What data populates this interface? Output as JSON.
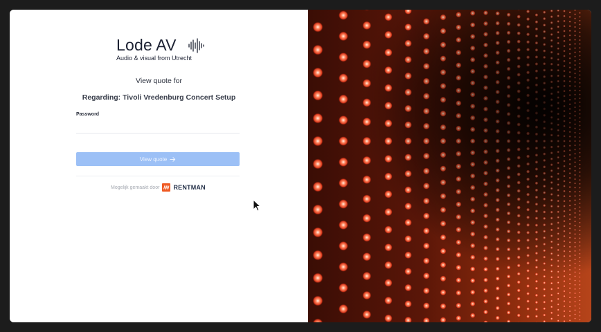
{
  "logo": {
    "name": "Lode AV",
    "tagline": "Audio & visual from Utrecht"
  },
  "page": {
    "heading": "View quote for",
    "regarding": "Regarding: Tivoli Vredenburg Concert Setup"
  },
  "form": {
    "password_label": "Password",
    "password_value": "",
    "submit_label": "View quote"
  },
  "footer": {
    "powered_by": "Mogelijk gemaakt door",
    "brand": "RENTMAN"
  },
  "colors": {
    "button": "#9cc0f6",
    "rentman_orange": "#ef5a24",
    "led_glow": "#ff6a3d"
  },
  "icons": {
    "arrow": "arrow-right-icon",
    "wave": "sound-wave-icon",
    "cursor": "mouse-cursor-icon"
  }
}
